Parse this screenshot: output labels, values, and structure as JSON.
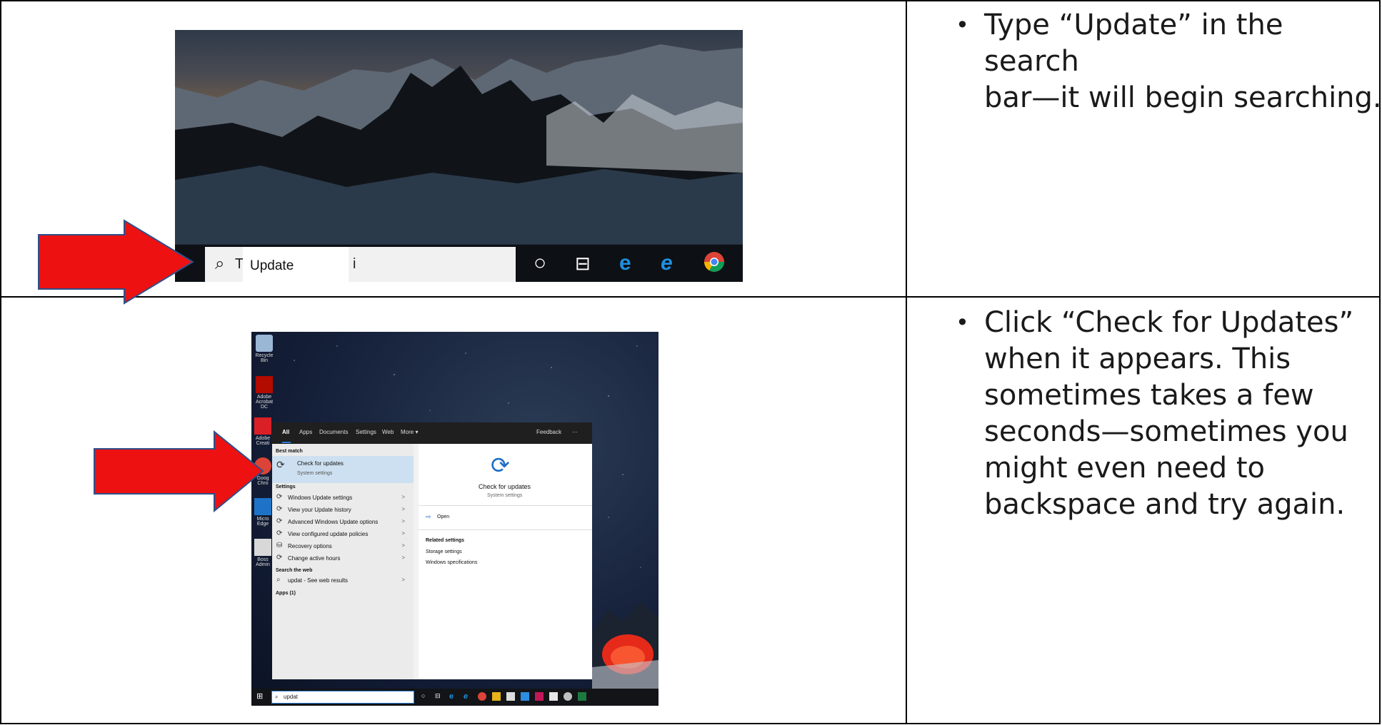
{
  "rows": [
    {
      "instruction": "Type “Update” in the search bar—it will begin searching.",
      "instruction_lines": [
        "Type “Update” in the search",
        "bar—it will begin searching."
      ],
      "screenshot": {
        "search_placeholder_start": "T",
        "search_placeholder_end": "i",
        "search_overlay_text": "Update"
      }
    },
    {
      "instruction_lines": [
        "Click “Check for Updates”",
        "when it appears. This",
        "sometimes takes a few",
        "seconds—sometimes you",
        "might even need to",
        "backspace and try again."
      ],
      "screenshot": {
        "desktop_icons": [
          "Recycle Bin",
          "Adobe Acrobat DC",
          "Adobe Creati",
          "Goog Chro",
          "Micro Edge",
          "Boss Admin"
        ],
        "tabs": [
          "All",
          "Apps",
          "Documents",
          "Settings",
          "Web",
          "More ▾",
          "Feedback",
          "···"
        ],
        "best_match_header": "Best match",
        "best_match": {
          "title": "Check for updates",
          "subtitle": "System settings"
        },
        "settings_header": "Settings",
        "settings_items": [
          "Windows Update settings",
          "View your Update history",
          "Advanced Windows Update options",
          "View configured update policies",
          "Recovery options",
          "Change active hours"
        ],
        "search_web_header": "Search the web",
        "web_item": "updat - See web results",
        "apps_header": "Apps (1)",
        "detail_title": "Check for updates",
        "detail_subtitle": "System settings",
        "open_label": "Open",
        "related_header": "Related settings",
        "related_items": [
          "Storage settings",
          "Windows specifications"
        ],
        "search_text": "updat"
      }
    }
  ],
  "colors": {
    "arrow_fill": "#ee1111",
    "arrow_stroke": "#2e4f8a",
    "highlight": "#cde0f1"
  }
}
